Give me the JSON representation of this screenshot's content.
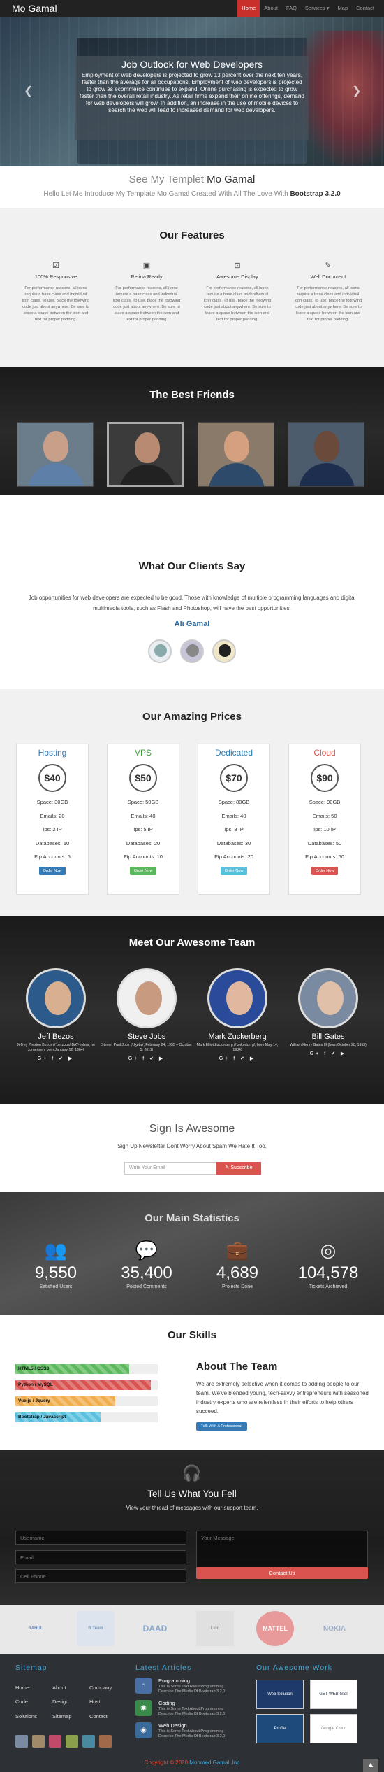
{
  "nav": {
    "brand": "Mo Gamal",
    "links": [
      "Home",
      "About",
      "FAQ",
      "Services",
      "Map",
      "Contact"
    ]
  },
  "hero": {
    "title": "Job Outlook for Web Developers",
    "text": "Employment of web developers is projected to grow 13 percent over the next ten years, faster than the average for all occupations. Employment of web developers is projected to grow as ecommerce continues to expand. Online purchasing is expected to grow faster than the overall retail industry. As retail firms expand their online offerings, demand for web developers will grow. In addition, an increase in the use of mobile devices to search the web will lead to increased demand for web developers."
  },
  "intro": {
    "title_prefix": "See My Templet",
    "title_name": "Mo Gamal",
    "sub_prefix": "Hello Let Me Introduce My Template Mo Gamal Created With All The Love With",
    "sub_bold": "Bootstrap 3.2.0"
  },
  "features": {
    "title": "Our Features",
    "items": [
      {
        "title": "100% Responsive",
        "icon": "checkbox-icon",
        "desc": "For performance reasons, all icons require a base class and individual icon class. To use, place the following code just about anywhere. Be sure to leave a space between the icon and text for proper padding."
      },
      {
        "title": "Retina Ready",
        "icon": "image-icon",
        "desc": "For performance reasons, all icons require a base class and individual icon class. To use, place the following code just about anywhere. Be sure to leave a space between the icon and text for proper padding."
      },
      {
        "title": "Awesome Display",
        "icon": "screenshot-icon",
        "desc": "For performance reasons, all icons require a base class and individual icon class. To use, place the following code just about anywhere. Be sure to leave a space between the icon and text for proper padding."
      },
      {
        "title": "Well Document",
        "icon": "edit-icon",
        "desc": "For performance reasons, all icons require a base class and individual icon class. To use, place the following code just about anywhere. Be sure to leave a space between the icon and text for proper padding."
      }
    ]
  },
  "friends": {
    "title": "The Best Friends"
  },
  "clients": {
    "title": "What Our Clients Say",
    "text": "Job opportunities for web developers are expected to be good. Those with knowledge of multiple programming languages and digital multimedia tools, such as Flash and Photoshop, will have the best opportunities.",
    "name": "Ali Gamal"
  },
  "pricing": {
    "title": "Our Amazing Prices",
    "plans": [
      {
        "name": "Hosting",
        "price": "$40",
        "color": "#337ab7",
        "btn_color": "#337ab7",
        "rows": [
          "Space: 30GB",
          "Emails: 20",
          "Ips: 2 IP",
          "Databases: 10",
          "Ftp Accounts: 5"
        ],
        "btn": "Order Now"
      },
      {
        "name": "VPS",
        "price": "$50",
        "color": "#3c9a3c",
        "btn_color": "#5cb85c",
        "rows": [
          "Space: 50GB",
          "Emails: 40",
          "Ips: 5 IP",
          "Databases: 20",
          "Ftp Accounts: 10"
        ],
        "btn": "Order Now"
      },
      {
        "name": "Dedicated",
        "price": "$70",
        "color": "#2c7fb8",
        "btn_color": "#5bc0de",
        "rows": [
          "Space: 80GB",
          "Emails: 40",
          "Ips: 8 IP",
          "Databases: 30",
          "Ftp Accounts: 20"
        ],
        "btn": "Order Now"
      },
      {
        "name": "Cloud",
        "price": "$90",
        "color": "#d9534f",
        "btn_color": "#d9534f",
        "rows": [
          "Space: 90GB",
          "Emails: 50",
          "Ips: 10 IP",
          "Databases: 50",
          "Ftp Accounts: 50"
        ],
        "btn": "Order Now"
      }
    ]
  },
  "team": {
    "title": "Meet Our Awesome Team",
    "social": "G+ f ✔ ▶",
    "members": [
      {
        "name": "Jeff Bezos",
        "desc": "Jeffrey Preston Bezos (/ˈbeɪzoʊs/ BAY-zohss; né Jorgensen; born January 12, 1964)"
      },
      {
        "name": "Steve Jobs",
        "desc": "Steven Paul Jobs (/dʒɒbz/; February 24, 1955 – October 5, 2011)"
      },
      {
        "name": "Mark Zuckerberg",
        "desc": "Mark Elliot Zuckerberg (/ˈzʌkərbɜːrɡ/; born May 14, 1984)"
      },
      {
        "name": "Bill Gates",
        "desc": "William Henry Gates III (born October 28, 1955)"
      }
    ]
  },
  "signup": {
    "title": "Sign Is Awesome",
    "sub": "Sign Up Newsletter Dont Worry About Spam We Hate It Too.",
    "placeholder": "Write Your Email",
    "button": "Subscribe"
  },
  "stats": {
    "title": "Our Main Statistics",
    "items": [
      {
        "value": "9,550",
        "label": "Satisfied Users",
        "icon": "users-icon"
      },
      {
        "value": "35,400",
        "label": "Posted Comments",
        "icon": "comments-icon"
      },
      {
        "value": "4,689",
        "label": "Projects Done",
        "icon": "briefcase-icon"
      },
      {
        "value": "104,578",
        "label": "Tickets Archieved",
        "icon": "lifebuoy-icon"
      }
    ]
  },
  "skills": {
    "title": "Our Skills",
    "bars": [
      {
        "label": "HTML5 / CSS3",
        "level": 0.8,
        "color": "#5cb85c"
      },
      {
        "label": "Python / MySQL",
        "level": 0.95,
        "color": "#d9534f"
      },
      {
        "label": "Vue.js / Jquery",
        "level": 0.7,
        "color": "#f0ad4e"
      },
      {
        "label": "Bootstrap / Javascript",
        "level": 0.6,
        "color": "#5bc0de"
      }
    ]
  },
  "about": {
    "title": "About The Team",
    "text": "We are extremely selective when it comes to adding people to our team. We've blended young, tech-savvy entrepreneurs with seasoned industry experts who are relentless in their efforts to help others succeed.",
    "button": "Talk With A Professional"
  },
  "contact": {
    "title": "Tell Us What You Fell",
    "sub": "View your thread of messages with our support team.",
    "username": "Username",
    "email": "Email",
    "phone": "Cell Phone",
    "message": "Your Message",
    "button": "Contact Us"
  },
  "logos": [
    "RAHUL",
    "R Team",
    "DAAD",
    "Lion",
    "MATTEL",
    "NOKIA"
  ],
  "footer": {
    "sitemap_title": "Sitemap",
    "sitemap": [
      "Home",
      "About",
      "Company",
      "Code",
      "Design",
      "Host",
      "Solutions",
      "Sitemap",
      "Contact"
    ],
    "articles_title": "Latest Articles",
    "articles": [
      {
        "title": "Programming",
        "desc": "This is Some Text About Programming Describe The Media Of Bootstrap 3.2.0"
      },
      {
        "title": "Coding",
        "desc": "This is Some Text About Programming Describe The Media Of Bootstrap 3.2.0"
      },
      {
        "title": "Web Design",
        "desc": "This is Some Text About Programming Describe The Media Of Bootstrap 3.2.0"
      }
    ],
    "work_title": "Our Awesome Work",
    "work": [
      "Web Solution",
      "GST WEB GST",
      "Profile",
      "Google Cloud"
    ],
    "copyright_prefix": "Copyright © 2020",
    "copyright_name": "Mohmed Gamal .Inc"
  }
}
